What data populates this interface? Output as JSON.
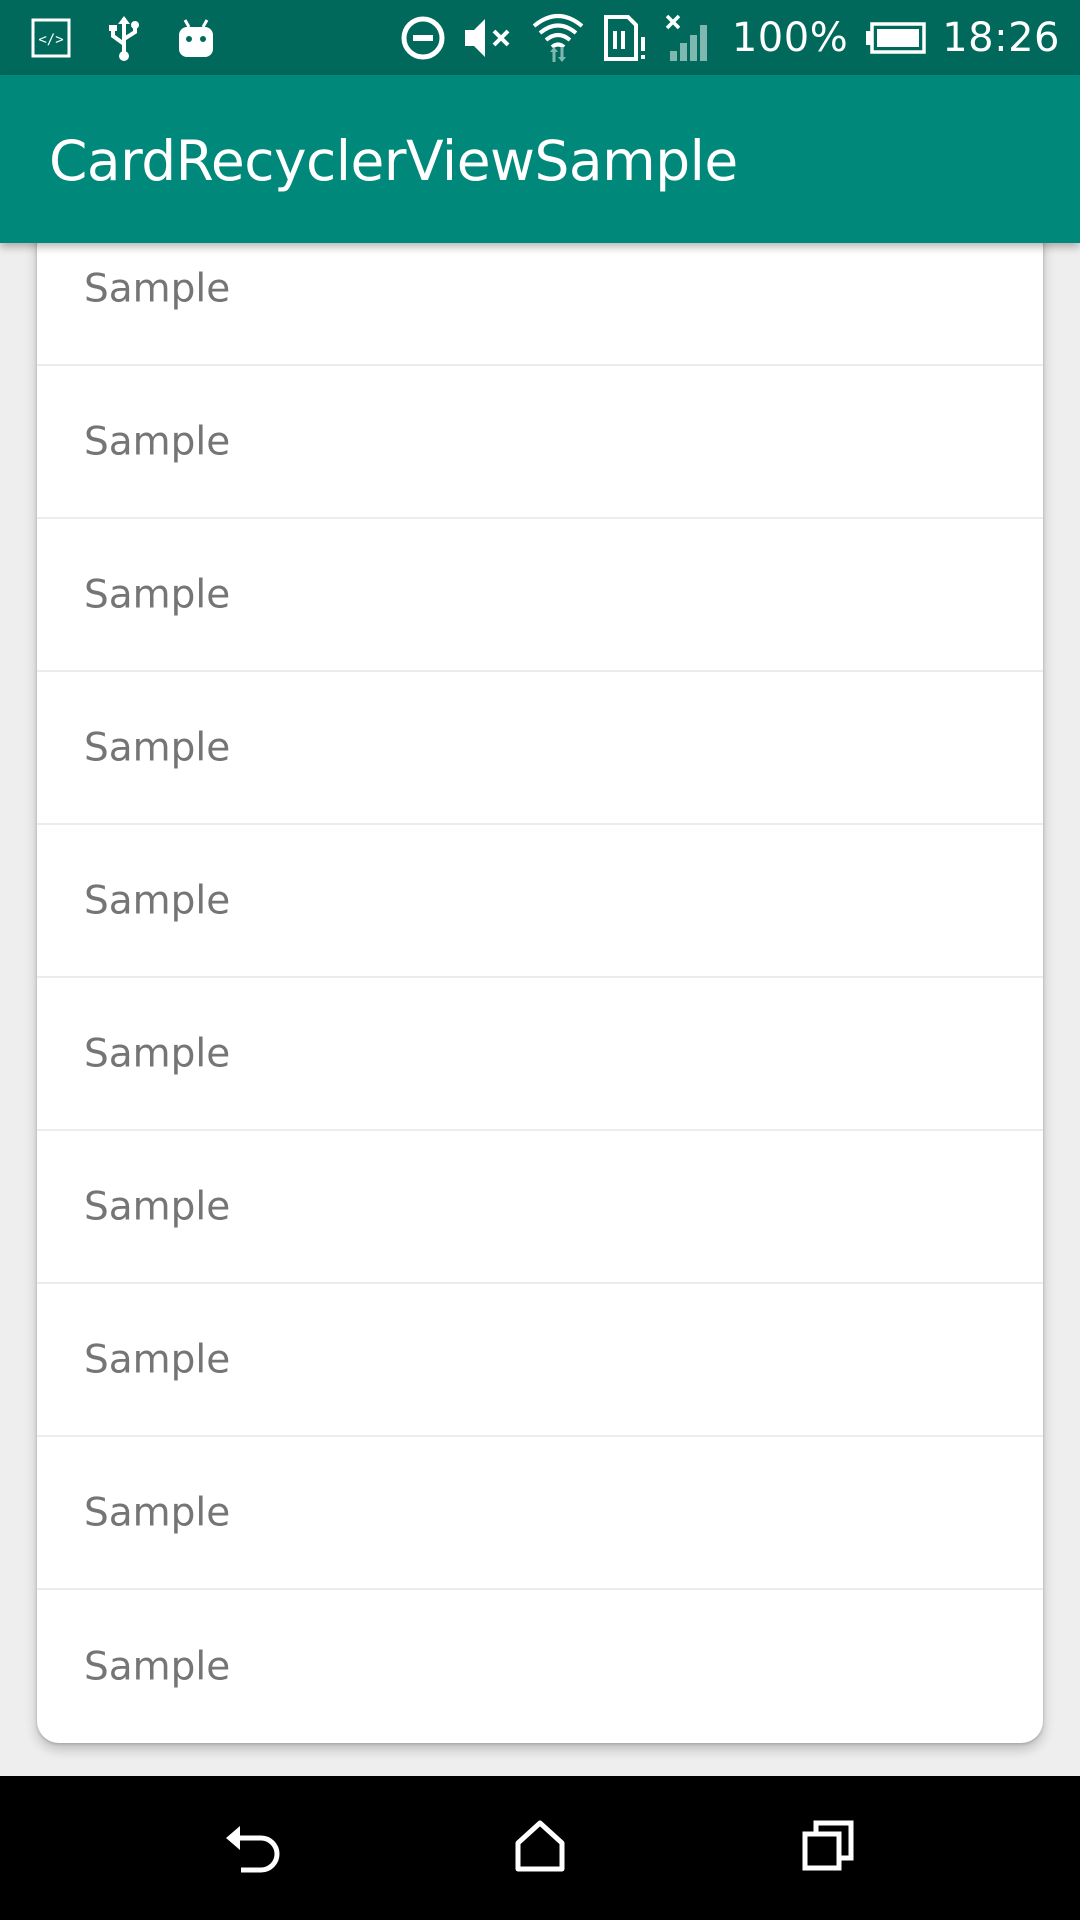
{
  "status_bar": {
    "icons_left": [
      "developer-code-icon",
      "usb-icon",
      "android-debug-icon"
    ],
    "icons_right": [
      "do-not-disturb-icon",
      "volume-muted-icon",
      "wifi-icon",
      "sim-alert-icon",
      "signal-no-service-icon"
    ],
    "battery_percent": "100%",
    "battery_level": 1.0,
    "time": "18:26",
    "background_color": "#00695c"
  },
  "app_bar": {
    "title": "CardRecyclerViewSample",
    "background_color": "#00897b"
  },
  "list": {
    "items": [
      {
        "label": "Sample"
      },
      {
        "label": "Sample"
      },
      {
        "label": "Sample"
      },
      {
        "label": "Sample"
      },
      {
        "label": "Sample"
      },
      {
        "label": "Sample"
      },
      {
        "label": "Sample"
      },
      {
        "label": "Sample"
      },
      {
        "label": "Sample"
      },
      {
        "label": "Sample"
      }
    ]
  },
  "nav_bar": {
    "buttons": [
      "back-icon",
      "home-icon",
      "recents-icon"
    ]
  }
}
